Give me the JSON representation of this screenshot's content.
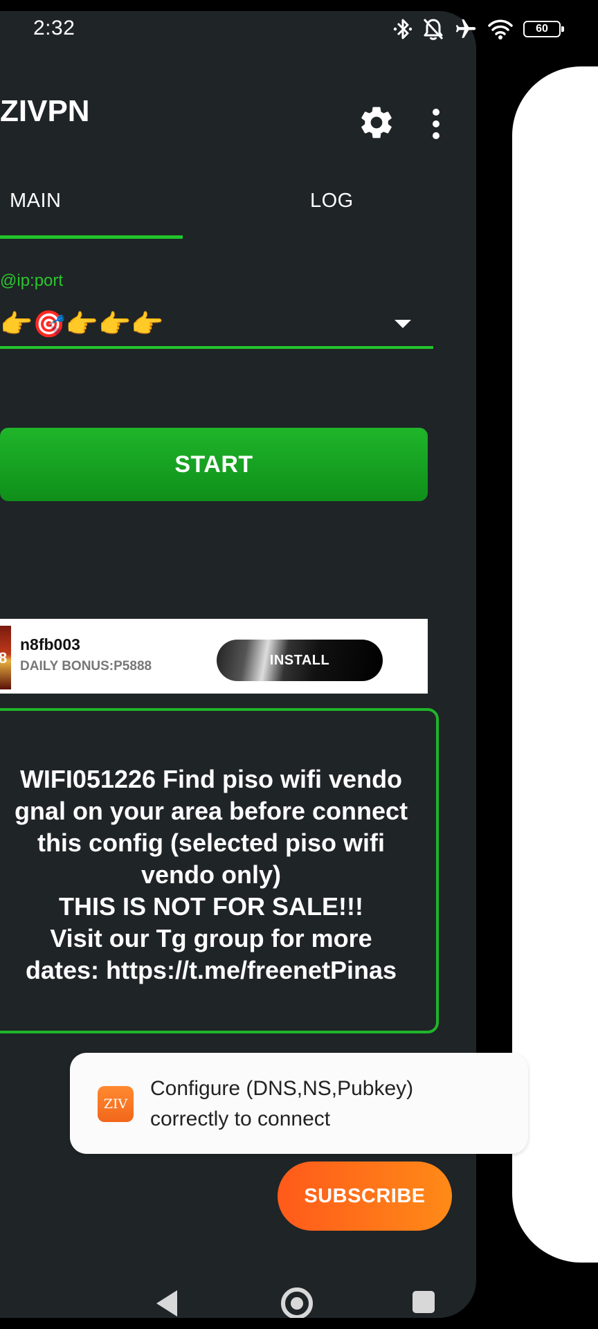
{
  "status_bar": {
    "time": "2:32",
    "battery": "60",
    "icons": [
      "bluetooth-icon",
      "bell-off-icon",
      "airplane-icon",
      "wifi-icon",
      "battery-icon"
    ]
  },
  "toolbar": {
    "title": "ZIVPN",
    "settings_icon": "gear-icon",
    "more_icon": "more-vertical-icon"
  },
  "tabs": [
    {
      "label": "MAIN",
      "selected": true
    },
    {
      "label": "LOG",
      "selected": false
    }
  ],
  "config_input": {
    "label": "@ip:port",
    "value": "👉🎯👉👉👉"
  },
  "start_button": {
    "label": "START"
  },
  "ad": {
    "thumb_text": "8",
    "title": "n8fb003",
    "subtitle": "DAILY BONUS:P5888",
    "install_label": "INSTALL"
  },
  "message": {
    "text": "WIFI051226 Find piso wifi vendo\ngnal on your area before connect\nthis config (selected piso wifi\nvendo only)\nTHIS IS NOT FOR SALE!!!\nVisit our Tg group for more\ndates: https://t.me/freenetPinas"
  },
  "subscribe_button": {
    "label": "SUBSCRIBE"
  },
  "toast": {
    "icon_text": "ZIV",
    "line1": "Configure (DNS,NS,Pubkey)",
    "line2": "correctly to connect"
  },
  "colors": {
    "accent_green": "#22c52b",
    "app_background": "#1f2427",
    "subscribe_orange": "#ff6a1a"
  }
}
